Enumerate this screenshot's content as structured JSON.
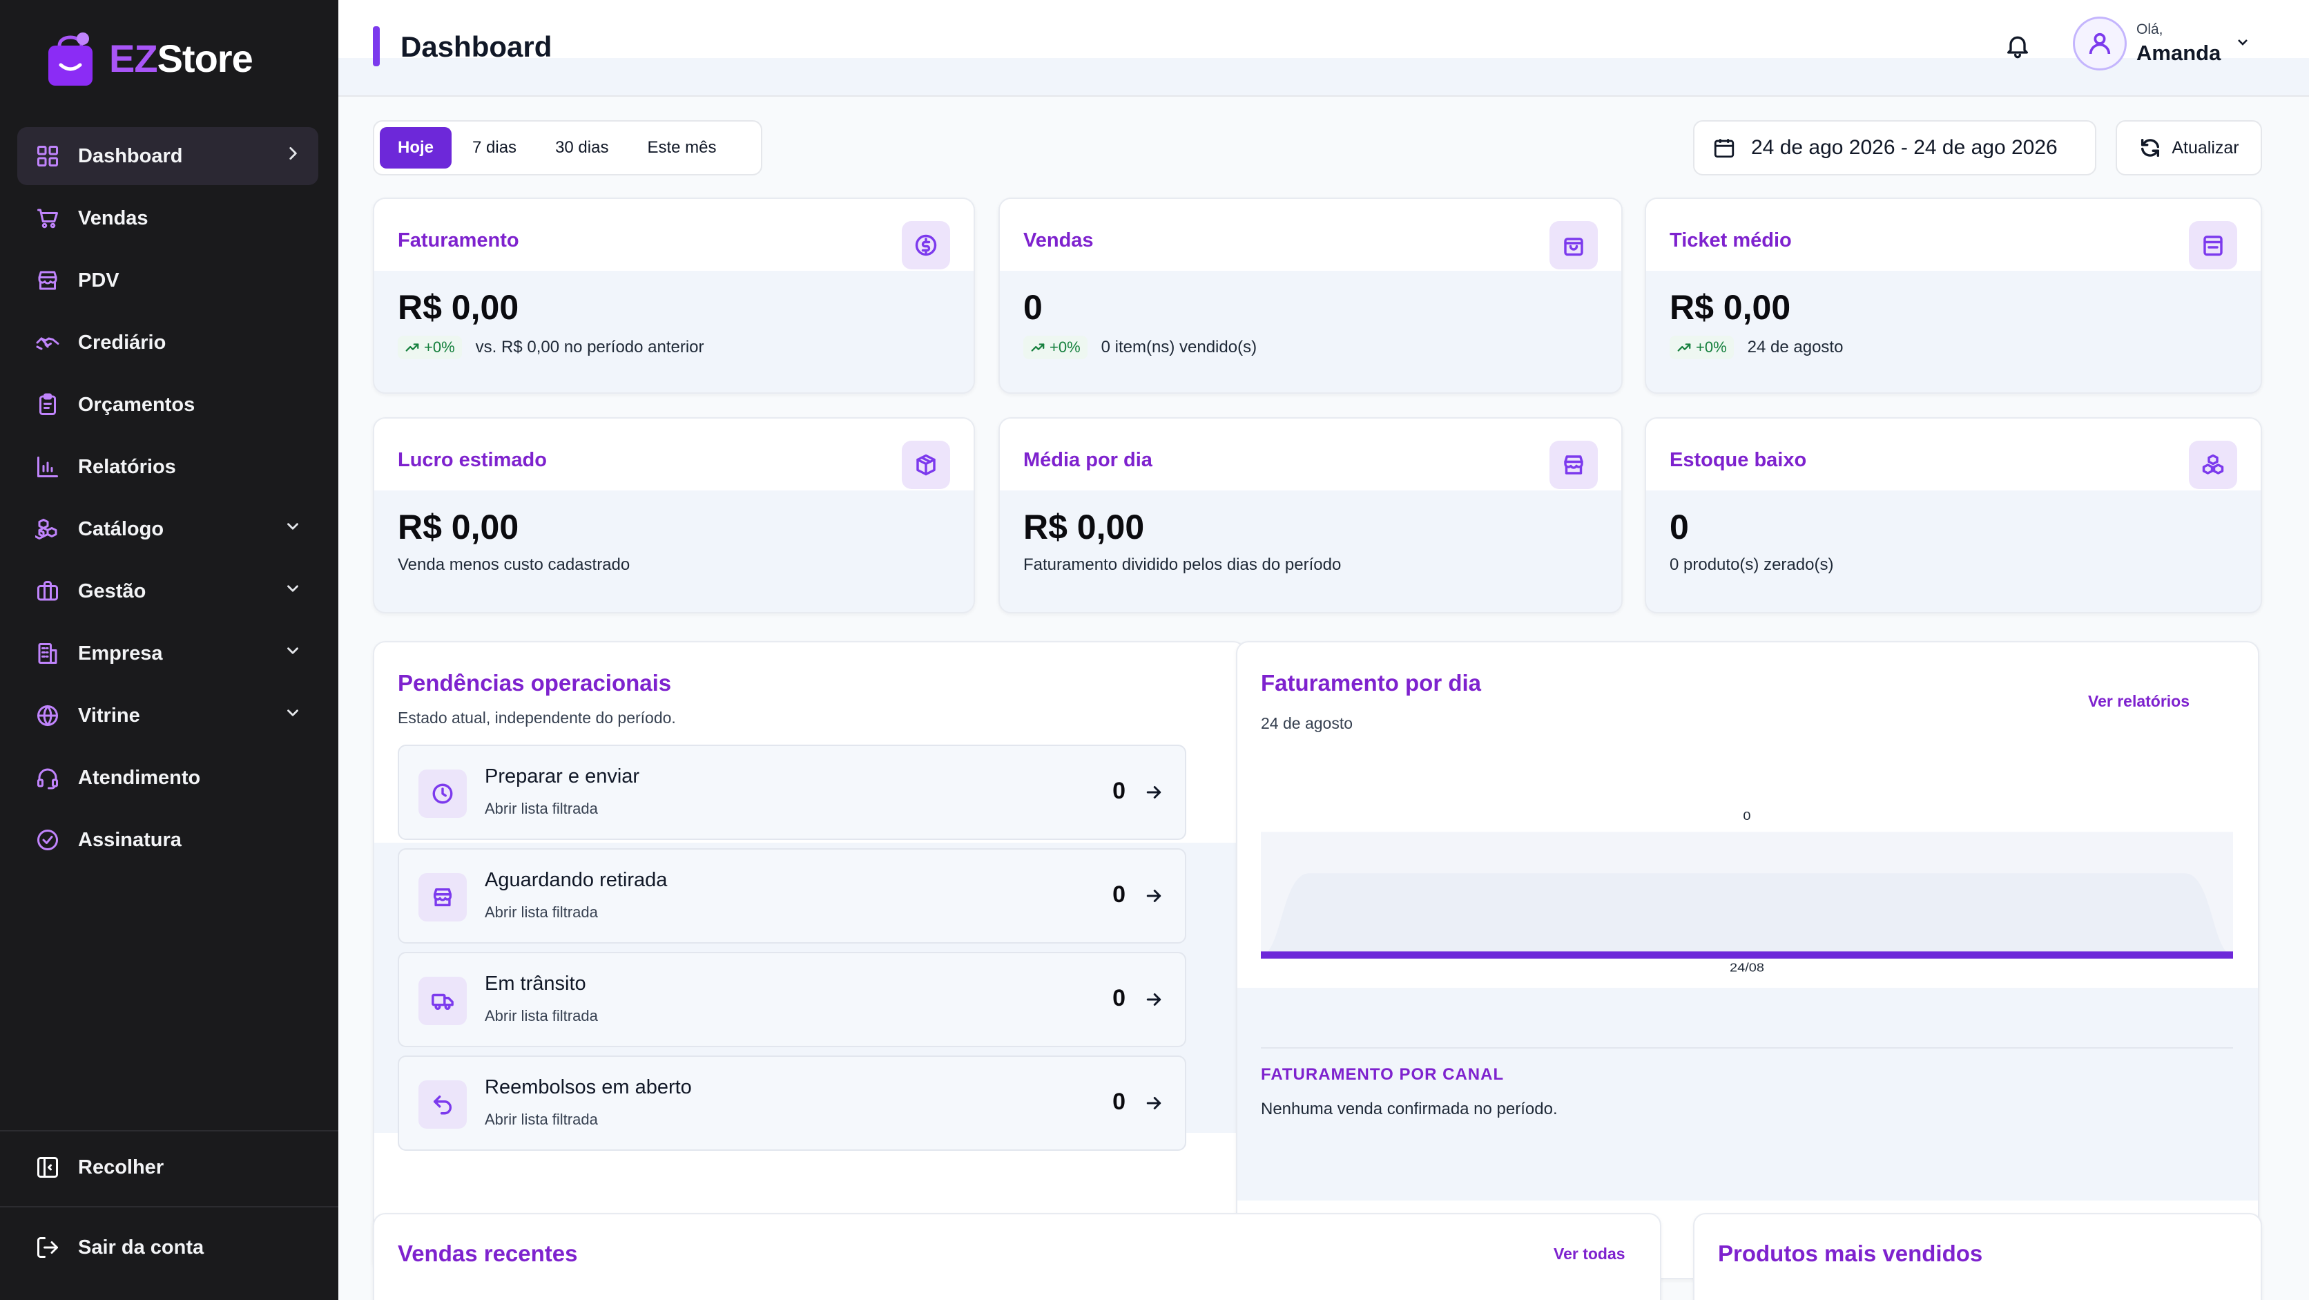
{
  "brand": {
    "ez": "EZ",
    "store": "Store",
    "accent": "#a855f7"
  },
  "sidebar": {
    "items": [
      {
        "label": "Dashboard",
        "icon": "dashboard-grid-icon",
        "active": true,
        "chevron": "chevron-right-icon"
      },
      {
        "label": "Vendas",
        "icon": "cart-icon"
      },
      {
        "label": "PDV",
        "icon": "store-icon"
      },
      {
        "label": "Crediário",
        "icon": "handshake-icon"
      },
      {
        "label": "Orçamentos",
        "icon": "clipboard-icon"
      },
      {
        "label": "Relatórios",
        "icon": "bar-chart-icon"
      },
      {
        "label": "Catálogo",
        "icon": "boxes-icon",
        "chevron": "chevron-down-icon"
      },
      {
        "label": "Gestão",
        "icon": "briefcase-icon",
        "chevron": "chevron-down-icon"
      },
      {
        "label": "Empresa",
        "icon": "building-icon",
        "chevron": "chevron-down-icon"
      },
      {
        "label": "Vitrine",
        "icon": "globe-icon",
        "chevron": "chevron-down-icon"
      },
      {
        "label": "Atendimento",
        "icon": "headset-icon"
      },
      {
        "label": "Assinatura",
        "icon": "check-circle-icon"
      }
    ],
    "collapse_label": "Recolher",
    "logout_label": "Sair da conta"
  },
  "header": {
    "title": "Dashboard",
    "greeting": "Olá,",
    "user_name": "Amanda"
  },
  "filters": {
    "tabs": [
      {
        "label": "Hoje",
        "active": true
      },
      {
        "label": "7 dias"
      },
      {
        "label": "30 dias"
      },
      {
        "label": "Este mês"
      }
    ],
    "date_range": "24 de ago 2026 - 24 de ago 2026",
    "refresh_label": "Atualizar"
  },
  "stats": [
    {
      "title": "Faturamento",
      "value": "R$ 0,00",
      "trend": "+0%",
      "note": "vs. R$ 0,00 no período anterior",
      "icon": "dollar-icon"
    },
    {
      "title": "Vendas",
      "value": "0",
      "trend": "+0%",
      "note": "0 item(ns) vendido(s)",
      "icon": "shopping-bag-icon"
    },
    {
      "title": "Ticket médio",
      "value": "R$ 0,00",
      "trend": "+0%",
      "note": "24 de agosto",
      "icon": "receipt-icon"
    },
    {
      "title": "Lucro estimado",
      "value": "R$ 0,00",
      "note": "Venda menos custo cadastrado",
      "icon": "package-icon"
    },
    {
      "title": "Média por dia",
      "value": "R$ 0,00",
      "note": "Faturamento dividido pelos dias do período",
      "icon": "storefront-icon"
    },
    {
      "title": "Estoque baixo",
      "value": "0",
      "note": "0 produto(s) zerado(s)",
      "icon": "boxes-icon"
    }
  ],
  "pendencias": {
    "title": "Pendências operacionais",
    "subtitle": "Estado atual, independente do período.",
    "items": [
      {
        "title": "Preparar e enviar",
        "sub": "Abrir lista filtrada",
        "count": "0",
        "icon": "clock-icon"
      },
      {
        "title": "Aguardando retirada",
        "sub": "Abrir lista filtrada",
        "count": "0",
        "icon": "storefront-icon"
      },
      {
        "title": "Em trânsito",
        "sub": "Abrir lista filtrada",
        "count": "0",
        "icon": "truck-icon"
      },
      {
        "title": "Reembolsos em aberto",
        "sub": "Abrir lista filtrada",
        "count": "0",
        "icon": "undo-icon"
      }
    ]
  },
  "faturamento_dia": {
    "title": "Faturamento por dia",
    "subtitle": "24 de agosto",
    "link": "Ver relatórios",
    "canal_title": "FATURAMENTO POR CANAL",
    "canal_empty": "Nenhuma venda confirmada no período."
  },
  "chart_data": {
    "type": "area",
    "x": [
      "24/08"
    ],
    "values": [
      0
    ],
    "data_labels": [
      "0"
    ],
    "title": "Faturamento por dia",
    "color": "#6d28d9"
  },
  "vendas_recentes": {
    "title": "Vendas recentes",
    "link": "Ver todas"
  },
  "produtos_mais_vendidos": {
    "title": "Produtos mais vendidos"
  }
}
